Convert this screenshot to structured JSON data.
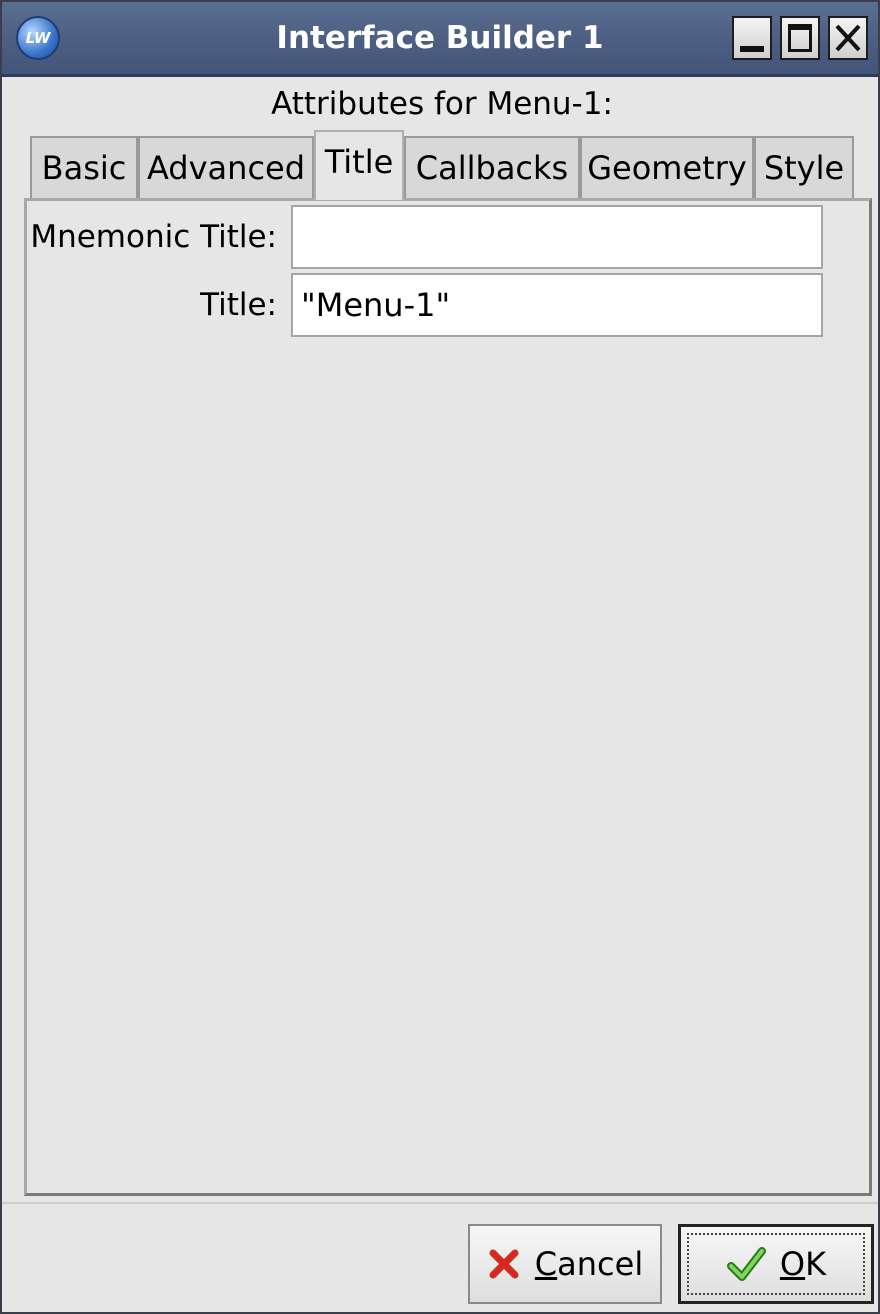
{
  "window": {
    "title": "Interface Builder 1",
    "logo_text": "LW"
  },
  "heading": "Attributes for Menu-1:",
  "tabs": [
    {
      "label": "Basic",
      "active": false
    },
    {
      "label": "Advanced",
      "active": false
    },
    {
      "label": "Title",
      "active": true
    },
    {
      "label": "Callbacks",
      "active": false
    },
    {
      "label": "Geometry",
      "active": false
    },
    {
      "label": "Style",
      "active": false
    }
  ],
  "fields": {
    "mnemonic_title": {
      "label": "Mnemonic Title:",
      "value": ""
    },
    "title": {
      "label": "Title:",
      "value": "\"Menu-1\""
    }
  },
  "buttons": {
    "cancel": {
      "mnemonic": "C",
      "rest": "ancel",
      "icon": "red-x-icon"
    },
    "ok": {
      "mnemonic": "O",
      "rest": "K",
      "icon": "green-check-icon"
    }
  },
  "colors": {
    "titlebar": "#4d5f82",
    "background": "#e6e6e6",
    "cancel_icon": "#d42a1e",
    "ok_icon": "#3aa52a"
  }
}
